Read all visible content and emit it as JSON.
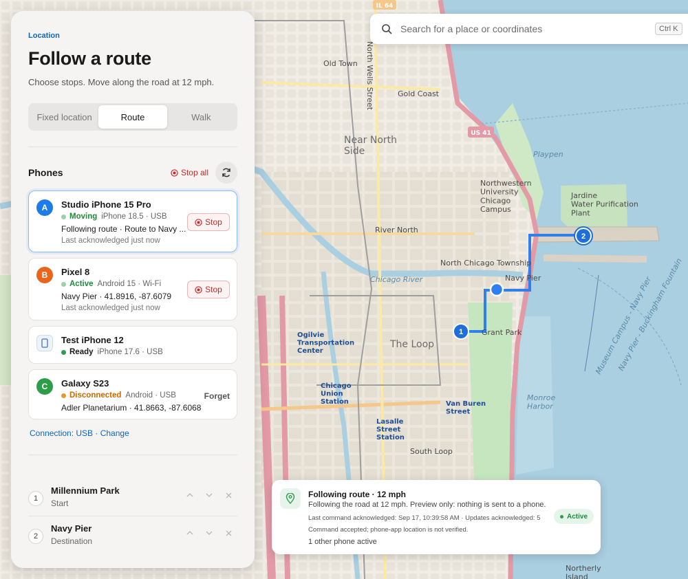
{
  "map": {
    "labels": {
      "old_town": "Old Town",
      "gold_coast": "Gold Coast",
      "near_north_side": "Near North\nSide",
      "river_north": "River North",
      "the_loop": "The Loop",
      "northwestern": "Northwestern\nUniversity\nChicago\nCampus",
      "jardine": "Jardine\nWater Purification\nPlant",
      "navy_pier": "Navy Pier",
      "grant_park": "Grant Park",
      "ogilvie": "Ogilvie\nTransportation\nCenter",
      "union": "Chicago\nUnion\nStation",
      "lasalle": "Lasalle\nStreet\nStation",
      "van_buren": "Van Buren\nStreet",
      "chicago_river": "Chicago River",
      "monroe_harbor": "Monroe\nHarbor",
      "playpen": "Playpen",
      "us41": "US 41",
      "il64": "IL 64",
      "north_wells": "North Wells Street",
      "museum_campus": "Museum Campus - Navy Pier",
      "buckingham": "Navy Pier - Buckingham Fountain",
      "north_chicago_township": "North Chicago Township",
      "south_loop": "South Loop",
      "northerly_island": "Northerly\nIsland",
      "marker_1": "1",
      "marker_2": "2"
    }
  },
  "search": {
    "placeholder": "Search for a place or coordinates",
    "shortcut": "Ctrl K"
  },
  "panel": {
    "eyebrow": "Location",
    "title": "Follow a route",
    "subtitle": "Choose stops. Move along the road at 12 mph.",
    "modes": [
      "Fixed location",
      "Route",
      "Walk"
    ],
    "active_mode": "Route",
    "phones_label": "Phones",
    "stop_all": "Stop all",
    "phones": [
      {
        "badge": "A",
        "name": "Studio iPhone 15 Pro",
        "status": "Moving",
        "status_color": "#1f8a3c",
        "device": "iPhone 18.5 · USB",
        "line": "Following route · Route to Navy ...",
        "ack": "Last acknowledged just now",
        "action": "Stop"
      },
      {
        "badge": "B",
        "name": "Pixel 8",
        "status": "Active",
        "status_color": "#1f8a3c",
        "device": "Android 15 · Wi-Fi",
        "line": "Navy Pier · 41.8916, -87.6079",
        "ack": "Last acknowledged just now",
        "action": "Stop"
      },
      {
        "badge": "",
        "name": "Test iPhone 12",
        "status": "Ready",
        "status_color": "#1a1a1a",
        "device": "iPhone 17.6 · USB"
      },
      {
        "badge": "C",
        "name": "Galaxy S23",
        "status": "Disconnected",
        "status_color": "#c96a00",
        "device": "Android · USB",
        "line": "Adler Planetarium · 41.8663, -87.6068",
        "action": "Forget"
      }
    ],
    "connection": "Connection: USB · Change",
    "stops": [
      {
        "num": "1",
        "name": "Millennium Park",
        "role": "Start"
      },
      {
        "num": "2",
        "name": "Navy Pier",
        "role": "Destination"
      }
    ]
  },
  "status": {
    "title": "Following route · 12 mph",
    "subtitle": "Following the road at 12 mph. Preview only: nothing is sent to a phone.",
    "meta": "Last command acknowledged: Sep 17, 10:39:58 AM · Updates acknowledged: 5",
    "meta2": "Command accepted; phone-app location is not verified.",
    "other": "1 other phone active",
    "pill": "Active"
  },
  "colors": {
    "accent": "#0a66c2",
    "route": "#2f80ed",
    "danger": "#c62828",
    "success": "#1f8a3c",
    "warning": "#c96a00",
    "avatar_a": "#1e7be8",
    "avatar_b": "#e8651e",
    "avatar_c": "#2e9d4a"
  }
}
